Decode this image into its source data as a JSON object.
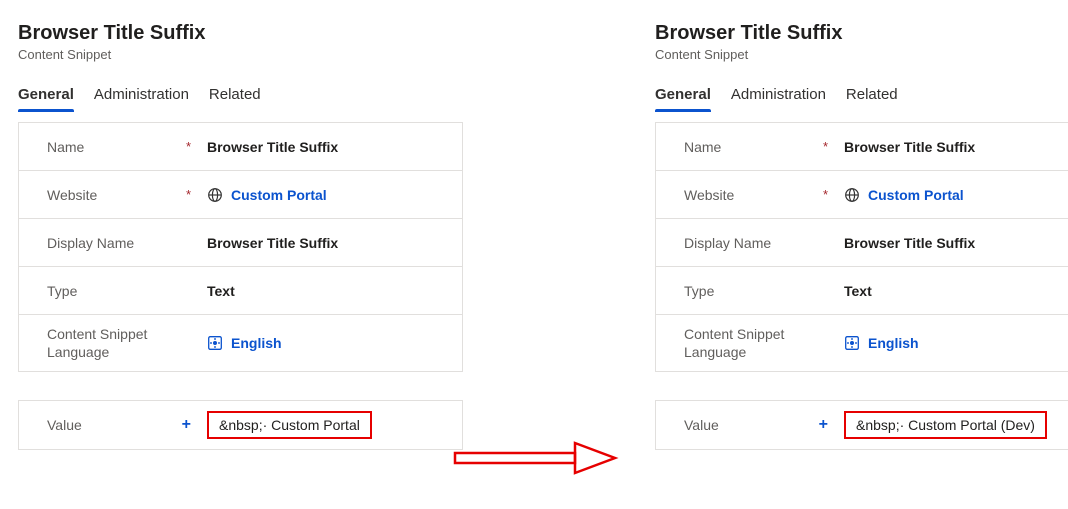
{
  "left": {
    "title": "Browser Title Suffix",
    "subtitle": "Content Snippet",
    "tabs": {
      "general": "General",
      "administration": "Administration",
      "related": "Related"
    },
    "labels": {
      "name": "Name",
      "website": "Website",
      "display_name": "Display Name",
      "type": "Type",
      "language": "Content Snippet Language",
      "value": "Value"
    },
    "values": {
      "name": "Browser Title Suffix",
      "website": "Custom Portal",
      "display_name": "Browser Title Suffix",
      "type": "Text",
      "language": "English",
      "value": "&nbsp;· Custom Portal"
    },
    "marks": {
      "required": "*",
      "optional": "+"
    }
  },
  "right": {
    "title": "Browser Title Suffix",
    "subtitle": "Content Snippet",
    "tabs": {
      "general": "General",
      "administration": "Administration",
      "related": "Related"
    },
    "labels": {
      "name": "Name",
      "website": "Website",
      "display_name": "Display Name",
      "type": "Type",
      "language": "Content Snippet Language",
      "value": "Value"
    },
    "values": {
      "name": "Browser Title Suffix",
      "website": "Custom Portal",
      "display_name": "Browser Title Suffix",
      "type": "Text",
      "language": "English",
      "value": "&nbsp;· Custom Portal (Dev)"
    },
    "marks": {
      "required": "*",
      "optional": "+"
    }
  }
}
